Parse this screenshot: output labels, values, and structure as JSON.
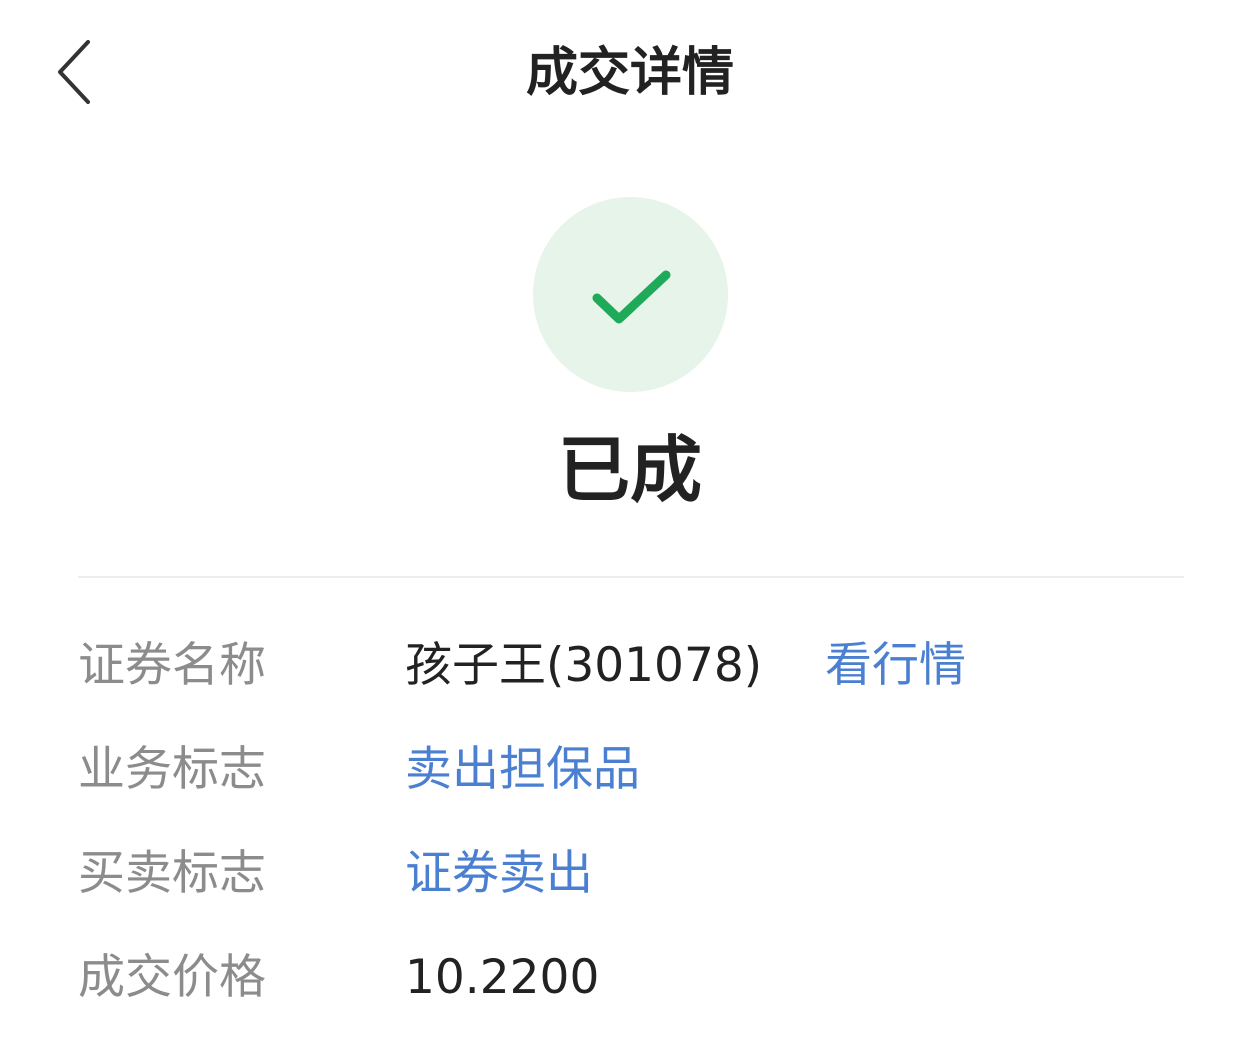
{
  "header": {
    "title": "成交详情",
    "back_icon": "chevron-left-icon"
  },
  "status": {
    "icon": "check-icon",
    "text": "已成",
    "circle_color": "#e6f4ea",
    "check_color": "#1faa59"
  },
  "details": {
    "security_name": {
      "label": "证券名称",
      "value": "孩子王(301078)",
      "link": "看行情"
    },
    "business_flag": {
      "label": "业务标志",
      "value": "卖出担保品"
    },
    "trade_flag": {
      "label": "买卖标志",
      "value": "证券卖出"
    },
    "price": {
      "label": "成交价格",
      "value": "10.2200"
    }
  },
  "colors": {
    "title": "#222222",
    "label": "#8c8c8c",
    "link": "#4a7fd1",
    "divider": "#ededed"
  }
}
